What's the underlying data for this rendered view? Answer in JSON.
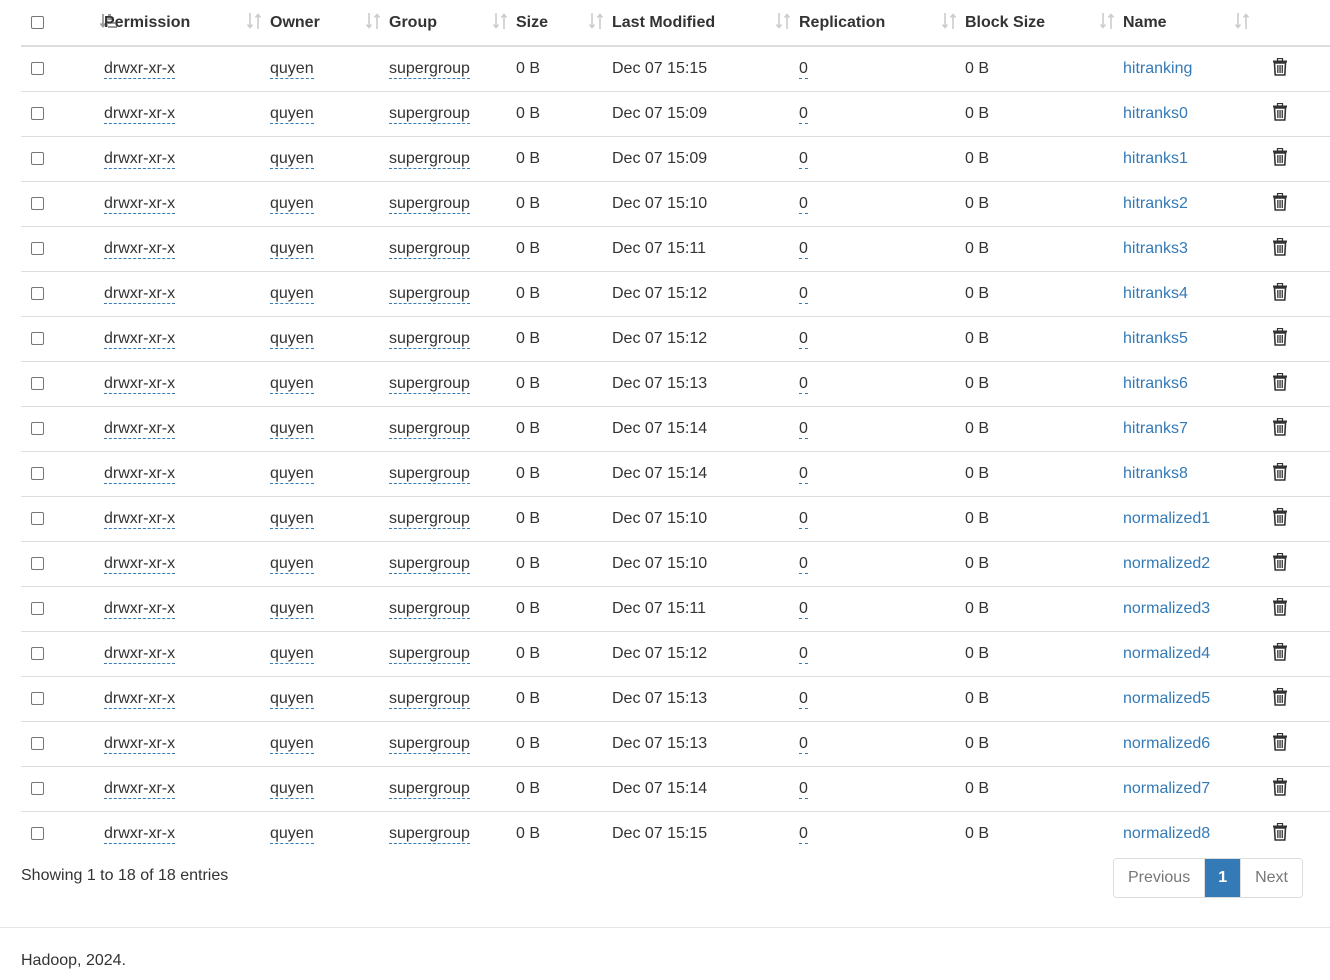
{
  "columns": {
    "permission": "Permission",
    "owner": "Owner",
    "group": "Group",
    "size": "Size",
    "last_modified": "Last Modified",
    "replication": "Replication",
    "block_size": "Block Size",
    "name": "Name"
  },
  "rows": [
    {
      "permission": "drwxr-xr-x",
      "owner": "quyen",
      "group": "supergroup",
      "size": "0 B",
      "modified": "Dec 07 15:15",
      "replication": "0",
      "block_size": "0 B",
      "name": "hitranking"
    },
    {
      "permission": "drwxr-xr-x",
      "owner": "quyen",
      "group": "supergroup",
      "size": "0 B",
      "modified": "Dec 07 15:09",
      "replication": "0",
      "block_size": "0 B",
      "name": "hitranks0"
    },
    {
      "permission": "drwxr-xr-x",
      "owner": "quyen",
      "group": "supergroup",
      "size": "0 B",
      "modified": "Dec 07 15:09",
      "replication": "0",
      "block_size": "0 B",
      "name": "hitranks1"
    },
    {
      "permission": "drwxr-xr-x",
      "owner": "quyen",
      "group": "supergroup",
      "size": "0 B",
      "modified": "Dec 07 15:10",
      "replication": "0",
      "block_size": "0 B",
      "name": "hitranks2"
    },
    {
      "permission": "drwxr-xr-x",
      "owner": "quyen",
      "group": "supergroup",
      "size": "0 B",
      "modified": "Dec 07 15:11",
      "replication": "0",
      "block_size": "0 B",
      "name": "hitranks3"
    },
    {
      "permission": "drwxr-xr-x",
      "owner": "quyen",
      "group": "supergroup",
      "size": "0 B",
      "modified": "Dec 07 15:12",
      "replication": "0",
      "block_size": "0 B",
      "name": "hitranks4"
    },
    {
      "permission": "drwxr-xr-x",
      "owner": "quyen",
      "group": "supergroup",
      "size": "0 B",
      "modified": "Dec 07 15:12",
      "replication": "0",
      "block_size": "0 B",
      "name": "hitranks5"
    },
    {
      "permission": "drwxr-xr-x",
      "owner": "quyen",
      "group": "supergroup",
      "size": "0 B",
      "modified": "Dec 07 15:13",
      "replication": "0",
      "block_size": "0 B",
      "name": "hitranks6"
    },
    {
      "permission": "drwxr-xr-x",
      "owner": "quyen",
      "group": "supergroup",
      "size": "0 B",
      "modified": "Dec 07 15:14",
      "replication": "0",
      "block_size": "0 B",
      "name": "hitranks7"
    },
    {
      "permission": "drwxr-xr-x",
      "owner": "quyen",
      "group": "supergroup",
      "size": "0 B",
      "modified": "Dec 07 15:14",
      "replication": "0",
      "block_size": "0 B",
      "name": "hitranks8"
    },
    {
      "permission": "drwxr-xr-x",
      "owner": "quyen",
      "group": "supergroup",
      "size": "0 B",
      "modified": "Dec 07 15:10",
      "replication": "0",
      "block_size": "0 B",
      "name": "normalized1"
    },
    {
      "permission": "drwxr-xr-x",
      "owner": "quyen",
      "group": "supergroup",
      "size": "0 B",
      "modified": "Dec 07 15:10",
      "replication": "0",
      "block_size": "0 B",
      "name": "normalized2"
    },
    {
      "permission": "drwxr-xr-x",
      "owner": "quyen",
      "group": "supergroup",
      "size": "0 B",
      "modified": "Dec 07 15:11",
      "replication": "0",
      "block_size": "0 B",
      "name": "normalized3"
    },
    {
      "permission": "drwxr-xr-x",
      "owner": "quyen",
      "group": "supergroup",
      "size": "0 B",
      "modified": "Dec 07 15:12",
      "replication": "0",
      "block_size": "0 B",
      "name": "normalized4"
    },
    {
      "permission": "drwxr-xr-x",
      "owner": "quyen",
      "group": "supergroup",
      "size": "0 B",
      "modified": "Dec 07 15:13",
      "replication": "0",
      "block_size": "0 B",
      "name": "normalized5"
    },
    {
      "permission": "drwxr-xr-x",
      "owner": "quyen",
      "group": "supergroup",
      "size": "0 B",
      "modified": "Dec 07 15:13",
      "replication": "0",
      "block_size": "0 B",
      "name": "normalized6"
    },
    {
      "permission": "drwxr-xr-x",
      "owner": "quyen",
      "group": "supergroup",
      "size": "0 B",
      "modified": "Dec 07 15:14",
      "replication": "0",
      "block_size": "0 B",
      "name": "normalized7"
    },
    {
      "permission": "drwxr-xr-x",
      "owner": "quyen",
      "group": "supergroup",
      "size": "0 B",
      "modified": "Dec 07 15:15",
      "replication": "0",
      "block_size": "0 B",
      "name": "normalized8"
    }
  ],
  "table_info": "Showing 1 to 18 of 18 entries",
  "pagination": {
    "previous": "Previous",
    "current": "1",
    "next": "Next"
  },
  "footer": {
    "copyright": "Hadoop, 2024."
  },
  "colors": {
    "link": "#337ab7",
    "active_page": "#337ab7",
    "border": "#dddddd"
  },
  "icons": {
    "sort": "sort-arrows-icon",
    "sort_active": "sort-amount-asc-icon",
    "delete": "trash-icon"
  }
}
